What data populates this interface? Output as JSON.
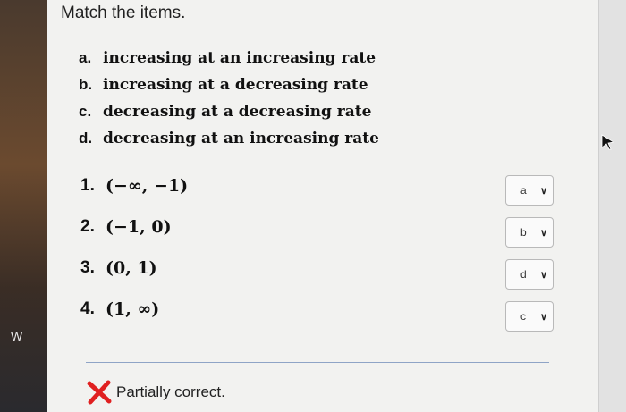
{
  "question": {
    "prompt": "Match the items.",
    "items": [
      {
        "letter": "a.",
        "text": "increasing at an increasing rate"
      },
      {
        "letter": "b.",
        "text": "increasing at a decreasing rate"
      },
      {
        "letter": "c.",
        "text": "decreasing at a decreasing rate"
      },
      {
        "letter": "d.",
        "text": "decreasing at an increasing rate"
      }
    ],
    "intervals": [
      {
        "number": "1.",
        "value": "(−∞, −1)"
      },
      {
        "number": "2.",
        "value": "(−1, 0)"
      },
      {
        "number": "3.",
        "value": "(0, 1)"
      },
      {
        "number": "4.",
        "value": "(1, ∞)"
      }
    ],
    "selections": [
      "a",
      "b",
      "d",
      "c"
    ]
  },
  "feedback": {
    "status": "Partially correct.",
    "status_icon": "x-mark-icon",
    "color": "#e02020"
  },
  "background": {
    "edge_text": "W"
  }
}
